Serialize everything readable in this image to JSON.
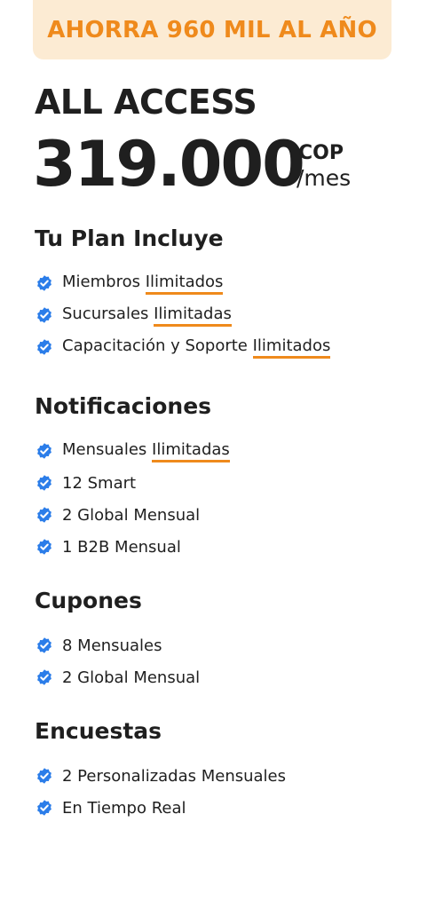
{
  "banner": {
    "text": "AHORRA 960 MIL AL AÑO"
  },
  "plan": {
    "name": "ALL ACCESS",
    "price": "319.000",
    "currency": "COP",
    "period": "/mes"
  },
  "colors": {
    "accent": "#ef8a1c",
    "banner_bg": "#fcebd3",
    "check": "#2b7de9",
    "text": "#1f1f1f"
  },
  "icons": {
    "check": "verified-check-icon"
  },
  "sections": [
    {
      "title": "Tu Plan Incluye",
      "items": [
        {
          "text": "Miembros ",
          "highlight": "Ilimitados"
        },
        {
          "text": "Sucursales ",
          "highlight": "Ilimitadas"
        },
        {
          "text": "Capacitación y Soporte ",
          "highlight": "Ilimitados"
        }
      ]
    },
    {
      "title": "Notificaciones",
      "items": [
        {
          "text": "Mensuales ",
          "highlight": "Ilimitadas"
        },
        {
          "text": "12 Smart",
          "highlight": ""
        },
        {
          "text": "2 Global Mensual",
          "highlight": ""
        },
        {
          "text": "1 B2B Mensual",
          "highlight": ""
        }
      ]
    },
    {
      "title": "Cupones",
      "items": [
        {
          "text": "8 Mensuales",
          "highlight": ""
        },
        {
          "text": "2 Global Mensual",
          "highlight": ""
        }
      ]
    },
    {
      "title": "Encuestas",
      "items": [
        {
          "text": "2 Personalizadas Mensuales",
          "highlight": ""
        },
        {
          "text": "En Tiempo Real",
          "highlight": ""
        }
      ]
    }
  ]
}
